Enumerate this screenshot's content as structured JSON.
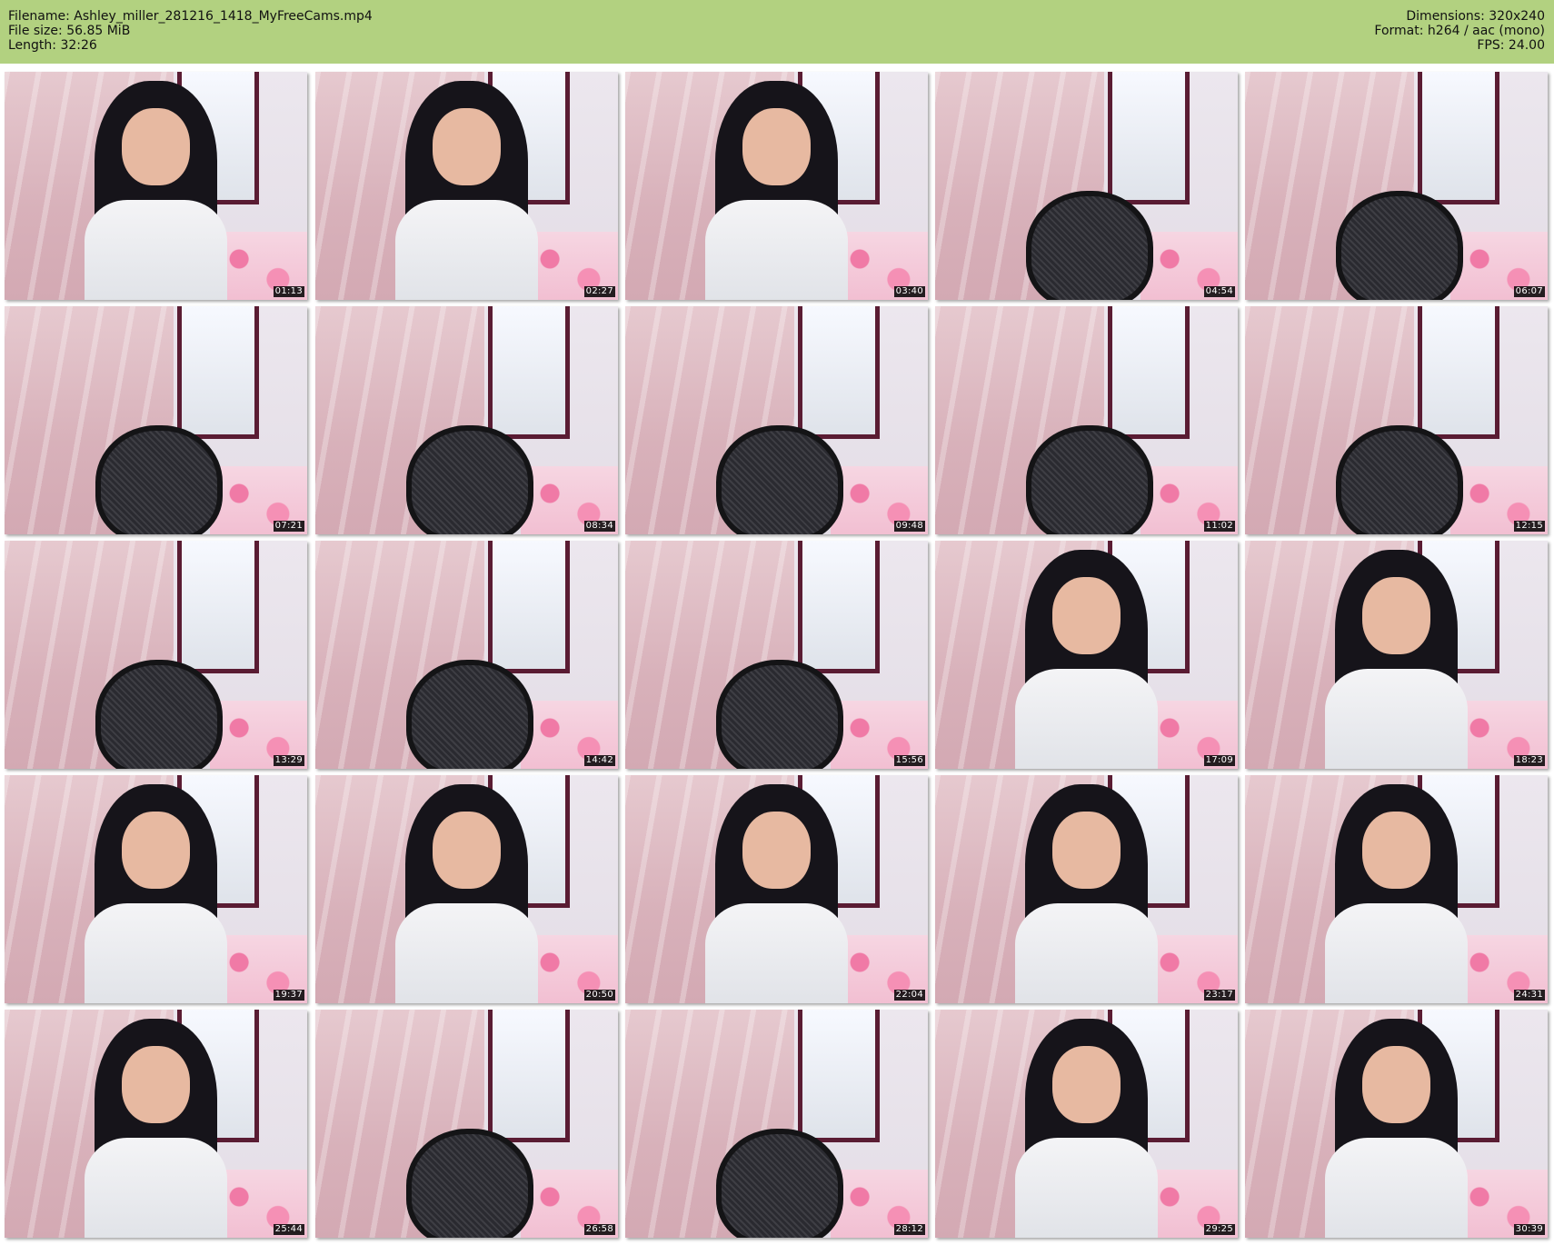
{
  "header": {
    "filename_line": "Filename: Ashley_miller_281216_1418_MyFreeCams.mp4",
    "filesize_line": "File size: 56.85 MiB",
    "length_line": "Length: 32:26",
    "dimensions_line": "Dimensions: 320x240",
    "format_line": "Format: h264 / aac (mono)",
    "fps_line": "FPS: 24.00",
    "background_color": "#b2d180"
  },
  "thumbnails": [
    {
      "time": "01:13",
      "scene": "person"
    },
    {
      "time": "02:27",
      "scene": "person"
    },
    {
      "time": "03:40",
      "scene": "person"
    },
    {
      "time": "04:54",
      "scene": "chair"
    },
    {
      "time": "06:07",
      "scene": "chair"
    },
    {
      "time": "07:21",
      "scene": "chair"
    },
    {
      "time": "08:34",
      "scene": "chair"
    },
    {
      "time": "09:48",
      "scene": "chair"
    },
    {
      "time": "11:02",
      "scene": "chair"
    },
    {
      "time": "12:15",
      "scene": "chair"
    },
    {
      "time": "13:29",
      "scene": "chair"
    },
    {
      "time": "14:42",
      "scene": "chair"
    },
    {
      "time": "15:56",
      "scene": "chair"
    },
    {
      "time": "17:09",
      "scene": "person"
    },
    {
      "time": "18:23",
      "scene": "person"
    },
    {
      "time": "19:37",
      "scene": "person"
    },
    {
      "time": "20:50",
      "scene": "person"
    },
    {
      "time": "22:04",
      "scene": "person"
    },
    {
      "time": "23:17",
      "scene": "person"
    },
    {
      "time": "24:31",
      "scene": "person"
    },
    {
      "time": "25:44",
      "scene": "person"
    },
    {
      "time": "26:58",
      "scene": "chair"
    },
    {
      "time": "28:12",
      "scene": "chair"
    },
    {
      "time": "29:25",
      "scene": "person"
    },
    {
      "time": "30:39",
      "scene": "person"
    }
  ]
}
